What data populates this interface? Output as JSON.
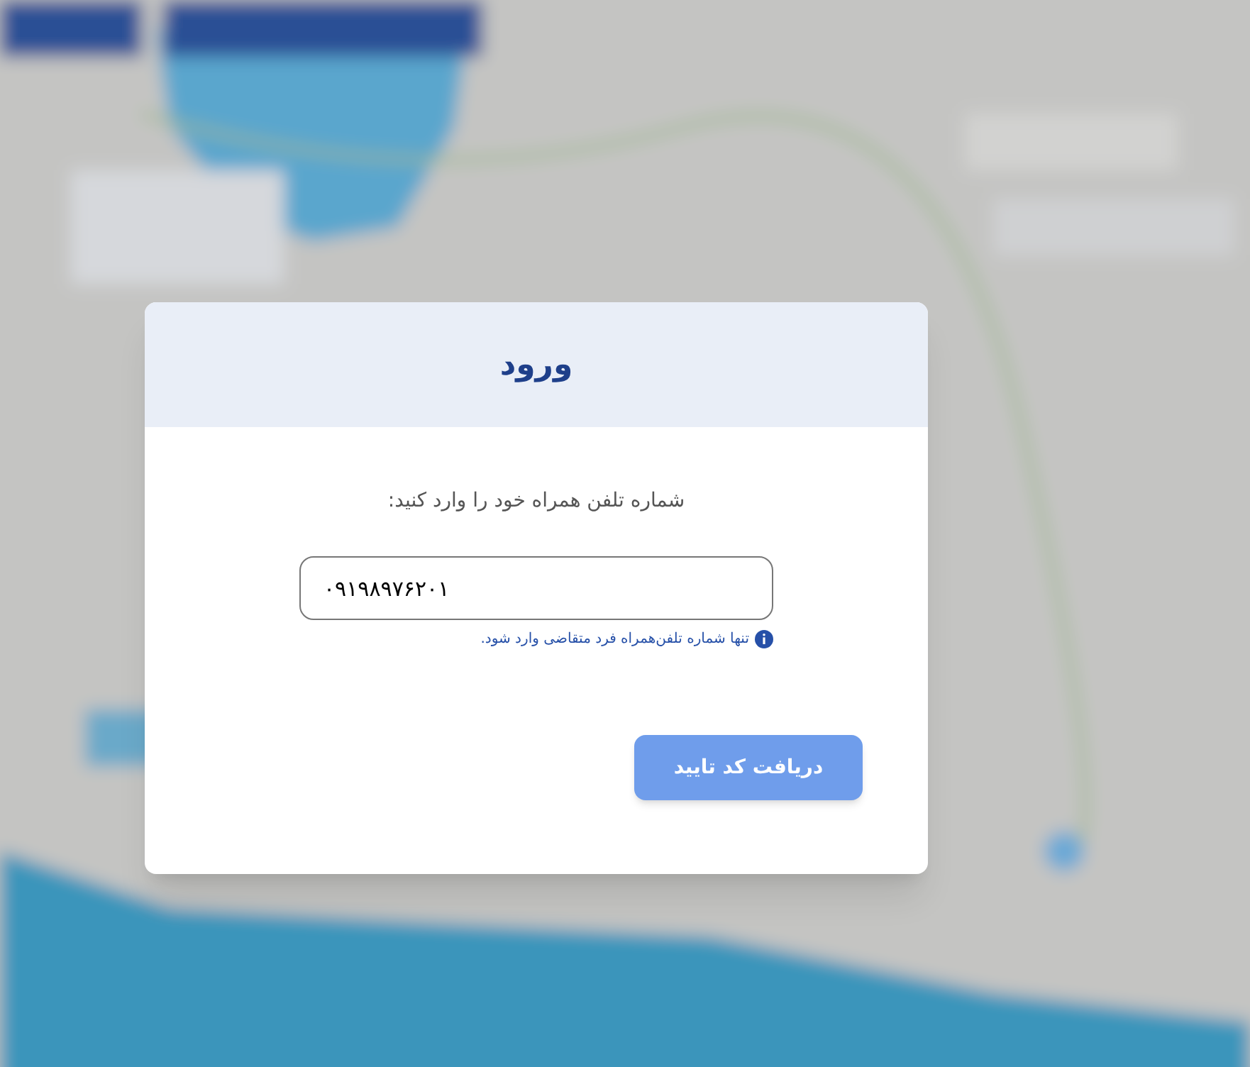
{
  "dialog": {
    "title": "ورود",
    "prompt": "شماره تلفن همراه خود را وارد کنید:",
    "phone_field": {
      "value": "۰۹۱۹۸۹۷۶۲۰۱"
    },
    "hint": "تنها شماره تلفن‌همراه فرد متقاضی وارد شود.",
    "submit_button": {
      "label": "دریافت کد تایید",
      "disabled": true
    }
  }
}
